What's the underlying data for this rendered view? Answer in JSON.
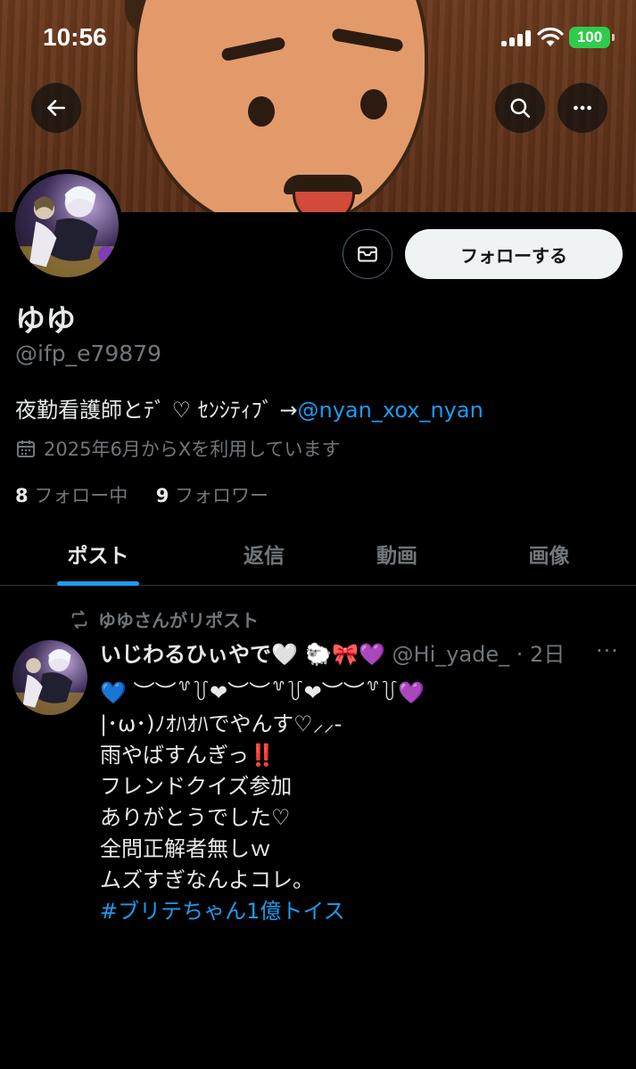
{
  "status_bar": {
    "time": "10:56",
    "battery": "100"
  },
  "profile": {
    "name": "ゆゆ",
    "handle": "@ifp_e79879",
    "bio_text": "夜勤看護師とﾃﾞ ♡ ｾﾝｼﾃｨﾌﾞ →",
    "bio_link": "@nyan_xox_nyan",
    "joined": "2025年6月からXを利用しています",
    "following_count": "8",
    "following_label": "フォロー中",
    "followers_count": "9",
    "followers_label": "フォロワー",
    "follow_button": "フォローする"
  },
  "tabs": [
    {
      "label": "ポスト",
      "active": true
    },
    {
      "label": "返信",
      "active": false
    },
    {
      "label": "動画",
      "active": false
    },
    {
      "label": "画像",
      "active": false
    }
  ],
  "post": {
    "repost_label": "ゆゆさんがリポスト",
    "author_name": "いじわるひぃやで🤍 🐑🎀💜",
    "author_handle": "@Hi_yade_",
    "time": "· 2日",
    "lines": [
      "💙 ︶︶꒷꒦❤︶︶꒷꒦❤︶︶꒷꒦💜",
      "",
      "|･ω･)ﾉｵﾊｵﾊでやんす♡⸝⸝-",
      "",
      "雨やばすんぎっ",
      "",
      "フレンドクイズ参加",
      "ありがとうでした♡",
      "全問正解者無しｗ",
      "",
      "ムズすぎなんよコレ。",
      ""
    ],
    "emphasis": "‼️",
    "hashtag": "#ブリテちゃん1億トイス"
  },
  "colors": {
    "accent": "#1d9bf0",
    "background": "#000000",
    "muted": "#71767b"
  }
}
